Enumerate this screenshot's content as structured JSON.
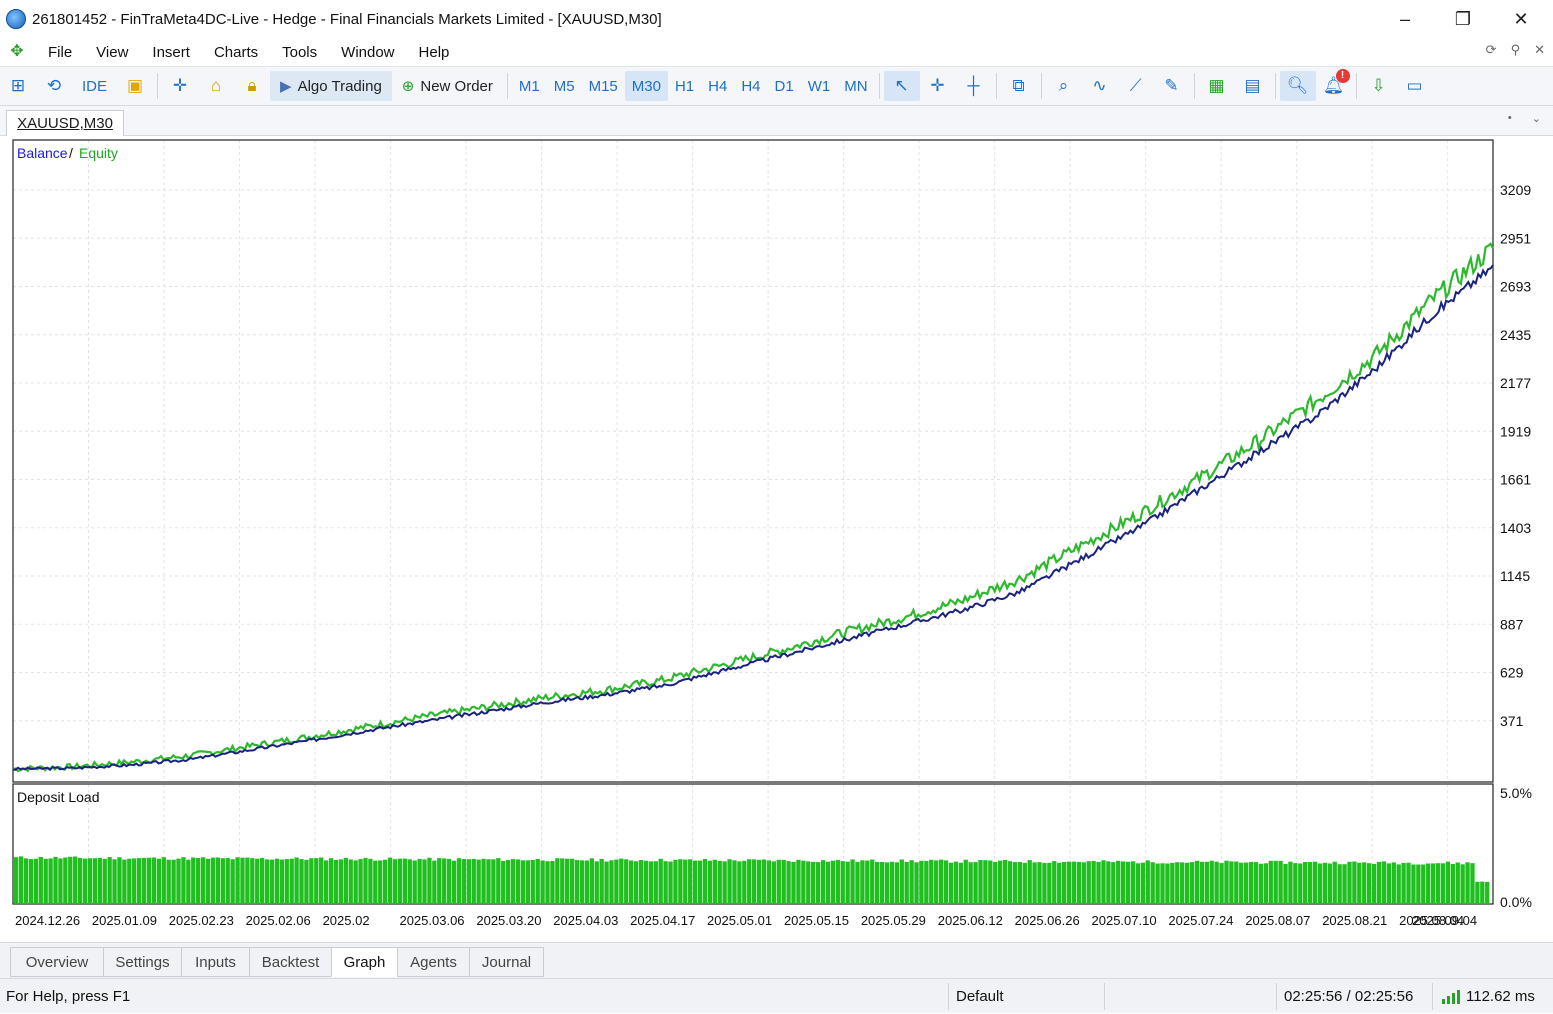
{
  "window": {
    "title": "261801452 - FinTraMeta4DC-Live - Hedge - Final Financials Markets Limited - [XAUUSD,M30]",
    "controls": {
      "minimize": "–",
      "maximize": "❐",
      "close": "✕"
    }
  },
  "menu": {
    "items": [
      "File",
      "View",
      "Insert",
      "Charts",
      "Tools",
      "Window",
      "Help"
    ]
  },
  "toolbar": {
    "ide_label": "IDE",
    "algo_trading_label": "Algo Trading",
    "new_order_label": "New Order",
    "timeframes": [
      "M1",
      "M5",
      "M15",
      "M30",
      "H1",
      "H4",
      "H4",
      "D1",
      "W1",
      "MN"
    ],
    "active_timeframe": "M30"
  },
  "chart_tab": {
    "label": "XAUUSD,M30"
  },
  "chart_data": [
    {
      "type": "line",
      "title": "",
      "legend": [
        "Balance",
        "Equity"
      ],
      "legend_placement": "top-left",
      "series": [
        {
          "name": "Balance",
          "color": "#1a237e"
        },
        {
          "name": "Equity",
          "color": "#2eb82e"
        }
      ],
      "x_tick_labels": [
        "2024.12.26",
        "2025.01.09",
        "2025.02.23",
        "2025.02.06",
        "2025.02",
        "2025.03.06",
        "2025.03.20",
        "2025.04.03",
        "2025.04.17",
        "2025.05.01",
        "2025.05.15",
        "2025.05.29",
        "2025.06.12",
        "2025.06.26",
        "2025.07.10",
        "2025.07.24",
        "2025.08.07",
        "2025.08.21",
        "2025.08.04",
        "2025.09.04"
      ],
      "y_tick_labels": [
        "3209",
        "2951",
        "2693",
        "2435",
        "2177",
        "1919",
        "1661",
        "1403",
        "1145",
        "887",
        "629",
        "371"
      ],
      "ylim": [
        113,
        3209
      ],
      "grid": true,
      "x": [
        0,
        12,
        24,
        36,
        48,
        60,
        72,
        84,
        96,
        108,
        120,
        132,
        144,
        156,
        168,
        180,
        192,
        204,
        216,
        228,
        240,
        252,
        264,
        276,
        288,
        300
      ],
      "balance": [
        113,
        118,
        135,
        165,
        215,
        265,
        320,
        370,
        420,
        470,
        510,
        560,
        640,
        720,
        800,
        880,
        960,
        1060,
        1230,
        1400,
        1600,
        1800,
        2000,
        2250,
        2550,
        2800
      ],
      "equity_note_values": [
        113,
        125,
        150,
        185,
        235,
        285,
        340,
        395,
        445,
        495,
        535,
        590,
        670,
        750,
        840,
        920,
        1010,
        1130,
        1300,
        1470,
        1660,
        1860,
        2080,
        2320,
        2630,
        2900
      ]
    },
    {
      "type": "bar",
      "title": "Deposit Load",
      "y_tick_labels": [
        "5.0%",
        "0.0%"
      ],
      "ylim": [
        0,
        5.0
      ],
      "color": "#1fbf1f",
      "bar_count": 300,
      "typical_value": 2.1
    }
  ],
  "chart": {
    "legend_balance": "Balance",
    "legend_sep": "/",
    "legend_equity": "Equity",
    "sub_title": "Deposit Load"
  },
  "bottom_tabs": [
    "Overview",
    "Settings",
    "Inputs",
    "Backtest",
    "Graph",
    "Agents",
    "Journal"
  ],
  "bottom_active": "Graph",
  "status": {
    "help": "For Help, press F1",
    "profile": "Default",
    "time": "02:25:56 / 02:25:56",
    "ping": "112.62 ms"
  }
}
